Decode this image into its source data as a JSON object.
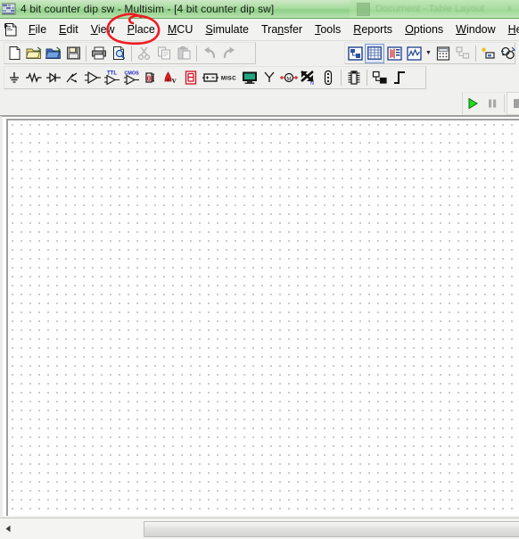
{
  "window": {
    "title": "4 bit counter dip sw - Multisim - [4 bit counter dip sw]",
    "icon": "multisim-app-icon",
    "ghost_title": "Document - Table Layout",
    "ghost_close": "x"
  },
  "menubar": {
    "system_icon": "document-system-icon",
    "items": [
      {
        "label": "File",
        "accel": "F",
        "name": "menu-file"
      },
      {
        "label": "Edit",
        "accel": "E",
        "name": "menu-edit"
      },
      {
        "label": "View",
        "accel": "V",
        "name": "menu-view"
      },
      {
        "label": "Place",
        "accel": "P",
        "name": "menu-place"
      },
      {
        "label": "MCU",
        "accel": "M",
        "name": "menu-mcu"
      },
      {
        "label": "Simulate",
        "accel": "S",
        "name": "menu-simulate"
      },
      {
        "label": "Transfer",
        "accel": "n",
        "name": "menu-transfer"
      },
      {
        "label": "Tools",
        "accel": "T",
        "name": "menu-tools"
      },
      {
        "label": "Reports",
        "accel": "R",
        "name": "menu-reports"
      },
      {
        "label": "Options",
        "accel": "O",
        "name": "menu-options"
      },
      {
        "label": "Window",
        "accel": "W",
        "name": "menu-window"
      },
      {
        "label": "Help",
        "accel": "H",
        "name": "menu-help"
      }
    ]
  },
  "annotation": {
    "type": "hand-drawn-ellipse",
    "color": "#ef1c23",
    "target": "Place"
  },
  "toolbar_standard": {
    "name": "standard-toolbar",
    "buttons": [
      {
        "name": "new-file-button",
        "icon": "new-document-icon",
        "enabled": true
      },
      {
        "name": "open-file-button",
        "icon": "open-folder-icon",
        "enabled": true
      },
      {
        "name": "open-sample-button",
        "icon": "open-folder-blue-icon",
        "enabled": true
      },
      {
        "name": "save-button",
        "icon": "floppy-disk-icon",
        "enabled": true
      },
      {
        "name": "print-button",
        "icon": "printer-icon",
        "enabled": true
      },
      {
        "name": "print-preview-button",
        "icon": "print-preview-icon",
        "enabled": true
      },
      {
        "name": "cut-button",
        "icon": "scissors-icon",
        "enabled": false
      },
      {
        "name": "copy-button",
        "icon": "copy-icon",
        "enabled": false
      },
      {
        "name": "paste-button",
        "icon": "clipboard-paste-icon",
        "enabled": false
      },
      {
        "name": "undo-button",
        "icon": "undo-arrow-icon",
        "enabled": false
      },
      {
        "name": "redo-button",
        "icon": "redo-arrow-icon",
        "enabled": false
      }
    ]
  },
  "toolbar_view": {
    "name": "view-toolbar",
    "buttons": [
      {
        "name": "design-toolbox-button",
        "icon": "design-toolbox-icon",
        "pressed": false
      },
      {
        "name": "spreadsheet-view-button",
        "icon": "spreadsheet-icon",
        "pressed": true
      },
      {
        "name": "sim-panel-button",
        "icon": "sim-panel-icon",
        "pressed": false
      },
      {
        "name": "grapher-button",
        "icon": "grapher-icon",
        "pressed": false
      },
      {
        "name": "grapher-dropdown",
        "icon": "chevron-down-icon",
        "pressed": false
      },
      {
        "name": "postprocessor-button",
        "icon": "calculator-icon",
        "pressed": false
      },
      {
        "name": "hierarchy-button",
        "icon": "hierarchy-icon",
        "pressed": false,
        "enabled": false
      },
      {
        "name": "new-subcircuit-button",
        "icon": "new-subcircuit-icon",
        "pressed": false
      },
      {
        "name": "bus-vector-connect-button",
        "icon": "bus-connect-icon",
        "pressed": false
      }
    ]
  },
  "toolbar_components": {
    "name": "components-toolbar",
    "buttons": [
      {
        "name": "place-source-button",
        "icon": "ground-source-icon"
      },
      {
        "name": "place-basic-button",
        "icon": "resistor-icon"
      },
      {
        "name": "place-diode-button",
        "icon": "diode-icon"
      },
      {
        "name": "place-transistor-button",
        "icon": "transistor-icon"
      },
      {
        "name": "place-analog-button",
        "icon": "opamp-icon"
      },
      {
        "name": "place-ttl-button",
        "icon": "ttl-gate-icon",
        "label": "TTL"
      },
      {
        "name": "place-cmos-button",
        "icon": "cmos-gate-icon",
        "label": "CMOS"
      },
      {
        "name": "place-misc-digital-button",
        "icon": "misc-digital-icon"
      },
      {
        "name": "place-mixed-button",
        "icon": "mixed-component-icon"
      },
      {
        "name": "place-indicator-button",
        "icon": "indicator-display-icon"
      },
      {
        "name": "place-power-button",
        "icon": "battery-power-icon"
      },
      {
        "name": "place-misc-button",
        "icon": "misc-icon",
        "label": "MISC"
      },
      {
        "name": "place-advanced-periph-button",
        "icon": "monitor-icon"
      },
      {
        "name": "place-rf-button",
        "icon": "antenna-icon"
      },
      {
        "name": "place-electromech-button",
        "icon": "motor-icon"
      },
      {
        "name": "place-ni-button",
        "icon": "ni-logo-icon"
      },
      {
        "name": "place-connector-button",
        "icon": "connector-icon"
      },
      {
        "name": "place-mcu-button",
        "icon": "mcu-chip-icon"
      },
      {
        "name": "place-hierarchical-button",
        "icon": "hierarchical-block-icon"
      },
      {
        "name": "place-bus-button",
        "icon": "bus-line-icon"
      }
    ]
  },
  "simulation_controls": {
    "name": "simulation-toolbar",
    "buttons": [
      {
        "name": "run-simulation-button",
        "icon": "play-icon",
        "color": "#22dd22",
        "enabled": true
      },
      {
        "name": "pause-simulation-button",
        "icon": "pause-icon",
        "color": "#a8a8a8",
        "enabled": false
      },
      {
        "name": "stop-simulation-button",
        "icon": "stop-icon",
        "color": "#a0a0a0",
        "enabled": false
      }
    ]
  },
  "canvas": {
    "name": "schematic-canvas",
    "grid": "dot-grid",
    "grid_spacing_px": 10,
    "background": "#ffffff",
    "dot_color": "#2b2b2b",
    "content": "empty"
  },
  "scrollbar": {
    "name": "horizontal-scrollbar",
    "left_arrow_icon": "triangle-left-icon",
    "thumb_position_pct": 25
  }
}
